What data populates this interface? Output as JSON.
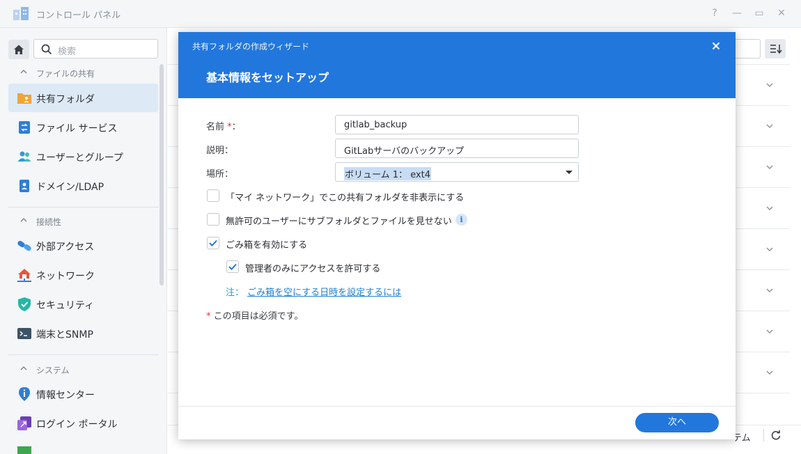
{
  "window": {
    "title": "コントロール パネル",
    "help_glyph": "?",
    "minimize_glyph": "—",
    "maximize_glyph": "▭",
    "close_glyph": "✕"
  },
  "sidebar": {
    "search_placeholder": "検索",
    "sections": [
      {
        "label": "ファイルの共有",
        "items": [
          {
            "label": "共有フォルダ",
            "icon": "shared-folder-icon",
            "active": true
          },
          {
            "label": "ファイル サービス",
            "icon": "file-services-icon"
          },
          {
            "label": "ユーザーとグループ",
            "icon": "users-groups-icon"
          },
          {
            "label": "ドメイン/LDAP",
            "icon": "domain-ldap-icon"
          }
        ]
      },
      {
        "label": "接続性",
        "items": [
          {
            "label": "外部アクセス",
            "icon": "external-access-icon"
          },
          {
            "label": "ネットワーク",
            "icon": "network-icon"
          },
          {
            "label": "セキュリティ",
            "icon": "security-icon"
          },
          {
            "label": "端末とSNMP",
            "icon": "terminal-icon"
          }
        ]
      },
      {
        "label": "システム",
        "items": [
          {
            "label": "情報センター",
            "icon": "info-center-icon"
          },
          {
            "label": "ログイン ポータル",
            "icon": "login-portal-icon"
          }
        ]
      }
    ]
  },
  "background": {
    "footer_text": "テム"
  },
  "wizard": {
    "window_title": "共有フォルダの作成ウィザード",
    "step_title": "基本情報をセットアップ",
    "fields": {
      "name_label": "名前",
      "name_required_mark": "*",
      "name_colon": "：",
      "name_value": "gitlab_backup",
      "description_label": "説明：",
      "description_value": "GitLabサーバのバックアップ",
      "location_label": "場所：",
      "location_value": "ボリューム 1： ext4"
    },
    "checkboxes": {
      "hide_network": {
        "label": "「マイ ネットワーク」でこの共有フォルダを非表示にする",
        "checked": false
      },
      "hide_subfolders": {
        "label": "無許可のユーザーにサブフォルダとファイルを見せない",
        "checked": false
      },
      "recycle_bin": {
        "label": "ごみ箱を有効にする",
        "checked": true
      },
      "admin_only": {
        "label": "管理者のみにアクセスを許可する",
        "checked": true
      }
    },
    "note_prefix": "注：",
    "note_link": "ごみ箱を空にする日時を設定するには",
    "required_mark": "*",
    "required_note": "この項目は必須です。",
    "next_button": "次へ"
  },
  "colors": {
    "accent": "#2277dd",
    "required": "#e0313b",
    "sidebar_bg": "#f4f6f8",
    "active_item_bg": "#dde9f5"
  }
}
